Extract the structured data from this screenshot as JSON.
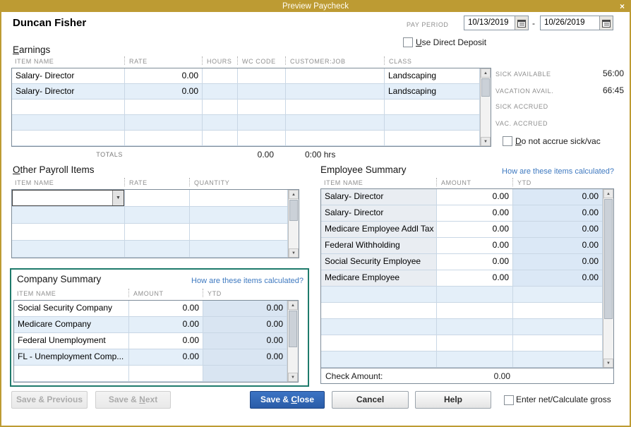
{
  "window": {
    "title": "Preview Paycheck",
    "close": "×"
  },
  "icons": {
    "scroll_up": "▲",
    "scroll_down": "▼",
    "combo_arrow": "▼"
  },
  "colors": {
    "title_bar_gold": "#BD9B33",
    "highlight_teal": "#1E7A6B",
    "primary_button_blue": "#2A5CA8",
    "link_blue": "#3E79C0",
    "row_alt_blue": "#E4EFF9"
  },
  "header": {
    "employee_name": "Duncan Fisher",
    "pay_period_label": "PAY PERIOD",
    "date_start": "10/13/2019",
    "date_separator": "-",
    "date_end": "10/26/2019",
    "use_direct_deposit": {
      "accel": "U",
      "rest": "se Direct Deposit"
    }
  },
  "earnings": {
    "title": {
      "accel": "E",
      "rest": "arnings"
    },
    "columns": [
      "ITEM NAME",
      "RATE",
      "HOURS",
      "WC CODE",
      "CUSTOMER:JOB",
      "CLASS"
    ],
    "rows": [
      {
        "item": "Salary- Director",
        "rate": "0.00",
        "hours": "",
        "wc": "",
        "customer": "",
        "class": "Landscaping"
      },
      {
        "item": "Salary- Director",
        "rate": "0.00",
        "hours": "",
        "wc": "",
        "customer": "",
        "class": "Landscaping"
      }
    ],
    "totals": {
      "label": "TOTALS",
      "rate": "0.00",
      "hours": "0:00 hrs"
    }
  },
  "accruals": {
    "rows": [
      {
        "label": "SICK AVAILABLE",
        "value": "56:00"
      },
      {
        "label": "VACATION AVAIL.",
        "value": "66:45"
      },
      {
        "label": "SICK ACCRUED",
        "value": ""
      },
      {
        "label": "VAC. ACCRUED",
        "value": ""
      }
    ],
    "do_not_accrue": {
      "accel": "D",
      "rest": "o not accrue sick/vac"
    }
  },
  "other_items": {
    "title": {
      "accel": "O",
      "rest": "ther Payroll Items"
    },
    "columns": [
      "ITEM NAME",
      "RATE",
      "QUANTITY"
    ],
    "selected_value": ""
  },
  "employee_summary": {
    "title": "Employee Summary",
    "link": "How are these items calculated?",
    "columns": [
      "ITEM NAME",
      "AMOUNT",
      "YTD"
    ],
    "rows": [
      {
        "item": "Salary- Director",
        "amount": "0.00",
        "ytd": "0.00"
      },
      {
        "item": "Salary- Director",
        "amount": "0.00",
        "ytd": "0.00"
      },
      {
        "item": "Medicare Employee Addl Tax",
        "amount": "0.00",
        "ytd": "0.00"
      },
      {
        "item": "Federal Withholding",
        "amount": "0.00",
        "ytd": "0.00"
      },
      {
        "item": "Social Security Employee",
        "amount": "0.00",
        "ytd": "0.00"
      },
      {
        "item": "Medicare Employee",
        "amount": "0.00",
        "ytd": "0.00"
      }
    ],
    "check_amount_label": "Check Amount:",
    "check_amount_value": "0.00"
  },
  "company_summary": {
    "title": "Company Summary",
    "link": "How are these items calculated?",
    "columns": [
      "ITEM NAME",
      "AMOUNT",
      "YTD"
    ],
    "rows": [
      {
        "item": "Social Security Company",
        "amount": "0.00",
        "ytd": "0.00"
      },
      {
        "item": "Medicare Company",
        "amount": "0.00",
        "ytd": "0.00"
      },
      {
        "item": "Federal Unemployment",
        "amount": "0.00",
        "ytd": "0.00"
      },
      {
        "item": "FL - Unemployment Comp...",
        "amount": "0.00",
        "ytd": "0.00"
      }
    ]
  },
  "footer": {
    "save_previous": "Save & Previous",
    "save_next": {
      "pre": "Save & ",
      "accel": "N",
      "rest": "ext"
    },
    "save_close": {
      "pre": "Save & ",
      "accel": "C",
      "rest": "lose"
    },
    "cancel": "Cancel",
    "help": "Help",
    "enter_net": {
      "pre": "Enter net/Calculate ",
      "accel": "g",
      "rest": "ross"
    }
  }
}
